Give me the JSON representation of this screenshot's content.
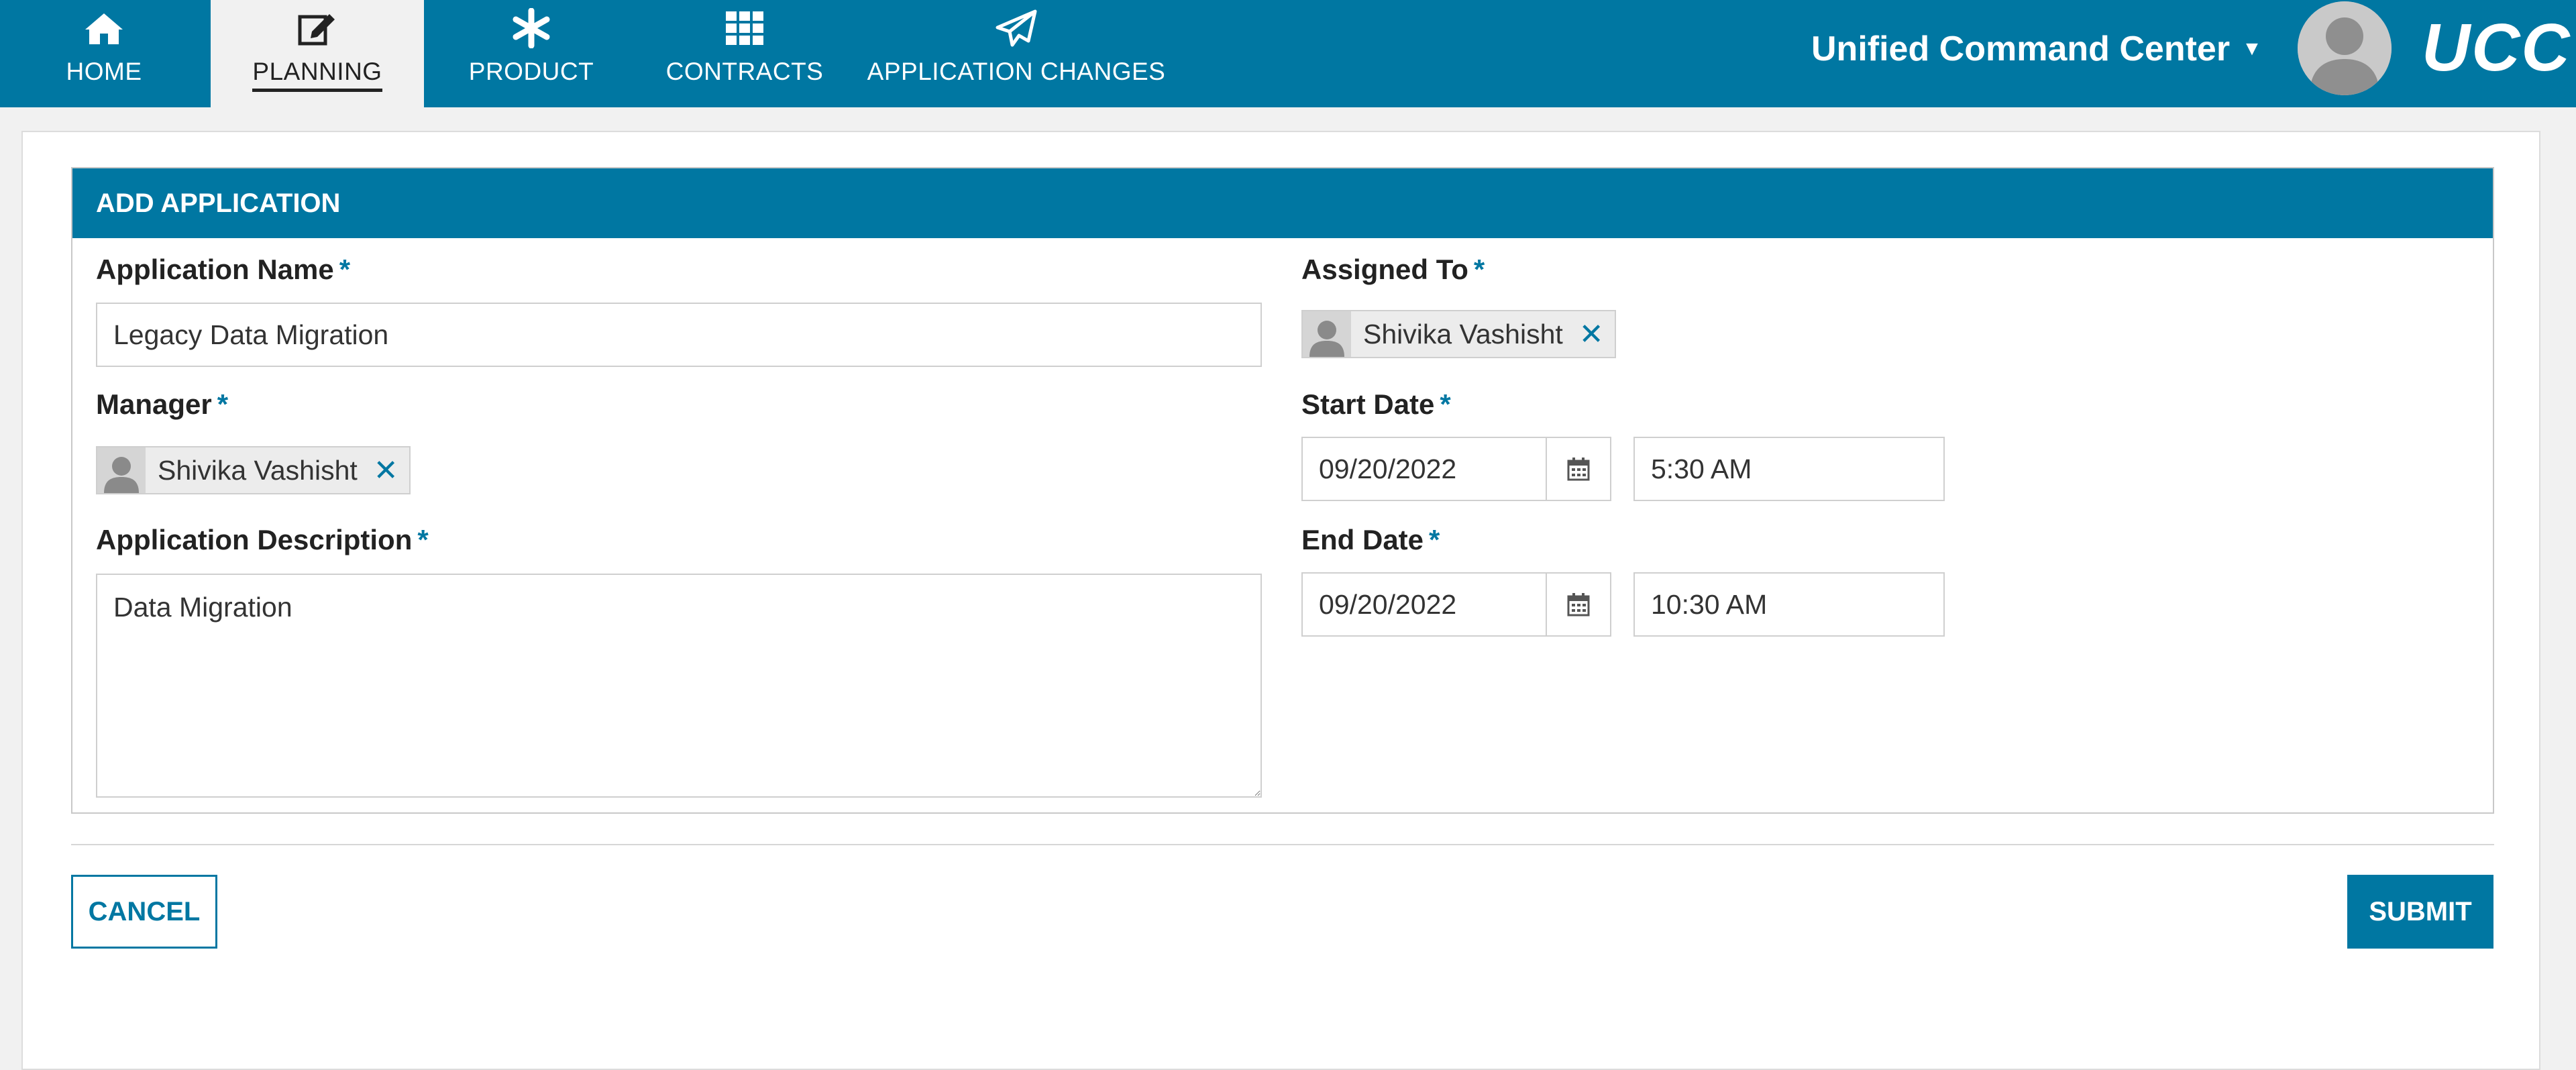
{
  "nav": {
    "tabs": [
      {
        "label": "HOME",
        "icon": "home-icon"
      },
      {
        "label": "PLANNING",
        "icon": "edit-icon",
        "active": true
      },
      {
        "label": "PRODUCT",
        "icon": "asterisk-icon"
      },
      {
        "label": "CONTRACTS",
        "icon": "grid-icon"
      },
      {
        "label": "APPLICATION CHANGES",
        "icon": "paper-plane-icon"
      }
    ],
    "brand_menu_label": "Unified Command Center",
    "logo_text": "UCC"
  },
  "form": {
    "header": "ADD APPLICATION",
    "application_name": {
      "label": "Application Name",
      "value": "Legacy Data Migration"
    },
    "manager": {
      "label": "Manager",
      "person": "Shivika Vashisht"
    },
    "description": {
      "label": "Application Description",
      "value": "Data Migration"
    },
    "assigned_to": {
      "label": "Assigned To",
      "person": "Shivika Vashisht"
    },
    "start_date": {
      "label": "Start Date",
      "date": "09/20/2022",
      "time": "5:30 AM"
    },
    "end_date": {
      "label": "End Date",
      "date": "09/20/2022",
      "time": "10:30 AM"
    },
    "required_mark": "*"
  },
  "actions": {
    "cancel_label": "CANCEL",
    "submit_label": "SUBMIT"
  },
  "colors": {
    "primary": "#0077a2",
    "background": "#f1f1f1"
  }
}
